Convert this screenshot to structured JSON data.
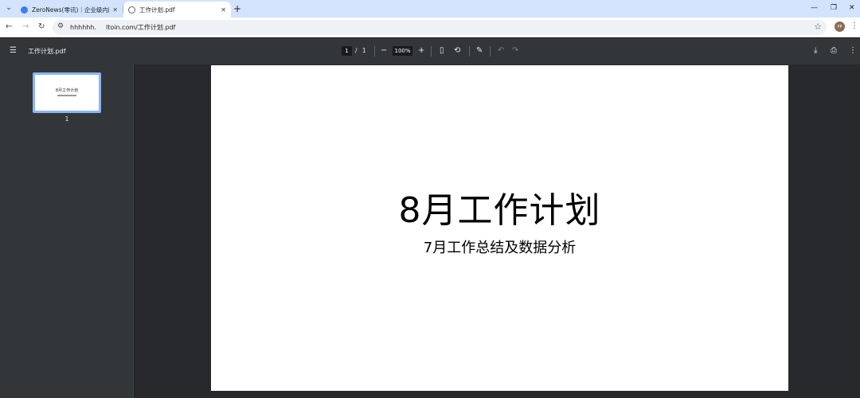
{
  "browser": {
    "tabs": [
      {
        "title": "ZeroNews(零讯)｜企业级内网穿",
        "active": false
      },
      {
        "title": "工作计划.pdf",
        "active": true
      }
    ],
    "new_tab": "+",
    "url": "hhhhhh.   ltoin.com/工作计划.pdf",
    "avatar_text": "PP"
  },
  "pdf_toolbar": {
    "file_name": "工作计划.pdf",
    "current_page": "1",
    "page_separator": "/",
    "total_pages": "1",
    "zoom": "100%"
  },
  "sidebar": {
    "thumbnails": [
      {
        "title": "8月工作计划",
        "page_number": "1"
      }
    ]
  },
  "document": {
    "title": "8月工作计划",
    "subtitle": "7月工作总结及数据分析"
  },
  "colors": {
    "tabstrip": "#d3e3fd",
    "pdf_toolbar": "#323639",
    "viewer_bg": "#28292c",
    "thumbnail_border": "#8ab4f8"
  }
}
